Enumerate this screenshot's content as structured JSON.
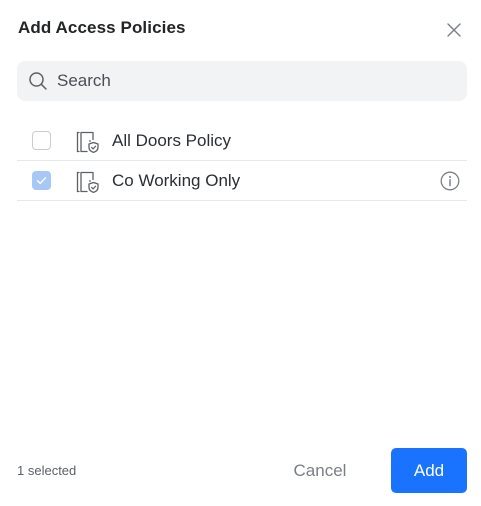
{
  "dialog": {
    "title": "Add Access Policies",
    "close_icon": "close-icon"
  },
  "search": {
    "placeholder": "Search",
    "value": "",
    "icon": "search-icon"
  },
  "policies": [
    {
      "label": "All Doors Policy",
      "checked": false,
      "icon": "door-shield-icon",
      "has_info": false
    },
    {
      "label": "Co Working Only",
      "checked": true,
      "icon": "door-shield-icon",
      "has_info": true
    }
  ],
  "footer": {
    "selected_count": "1 selected",
    "cancel_label": "Cancel",
    "add_label": "Add"
  },
  "colors": {
    "accent": "#1a73ff",
    "checkbox_checked": "#a7c8f7",
    "search_bg": "#f2f3f5",
    "divider": "#e6e8eb"
  }
}
